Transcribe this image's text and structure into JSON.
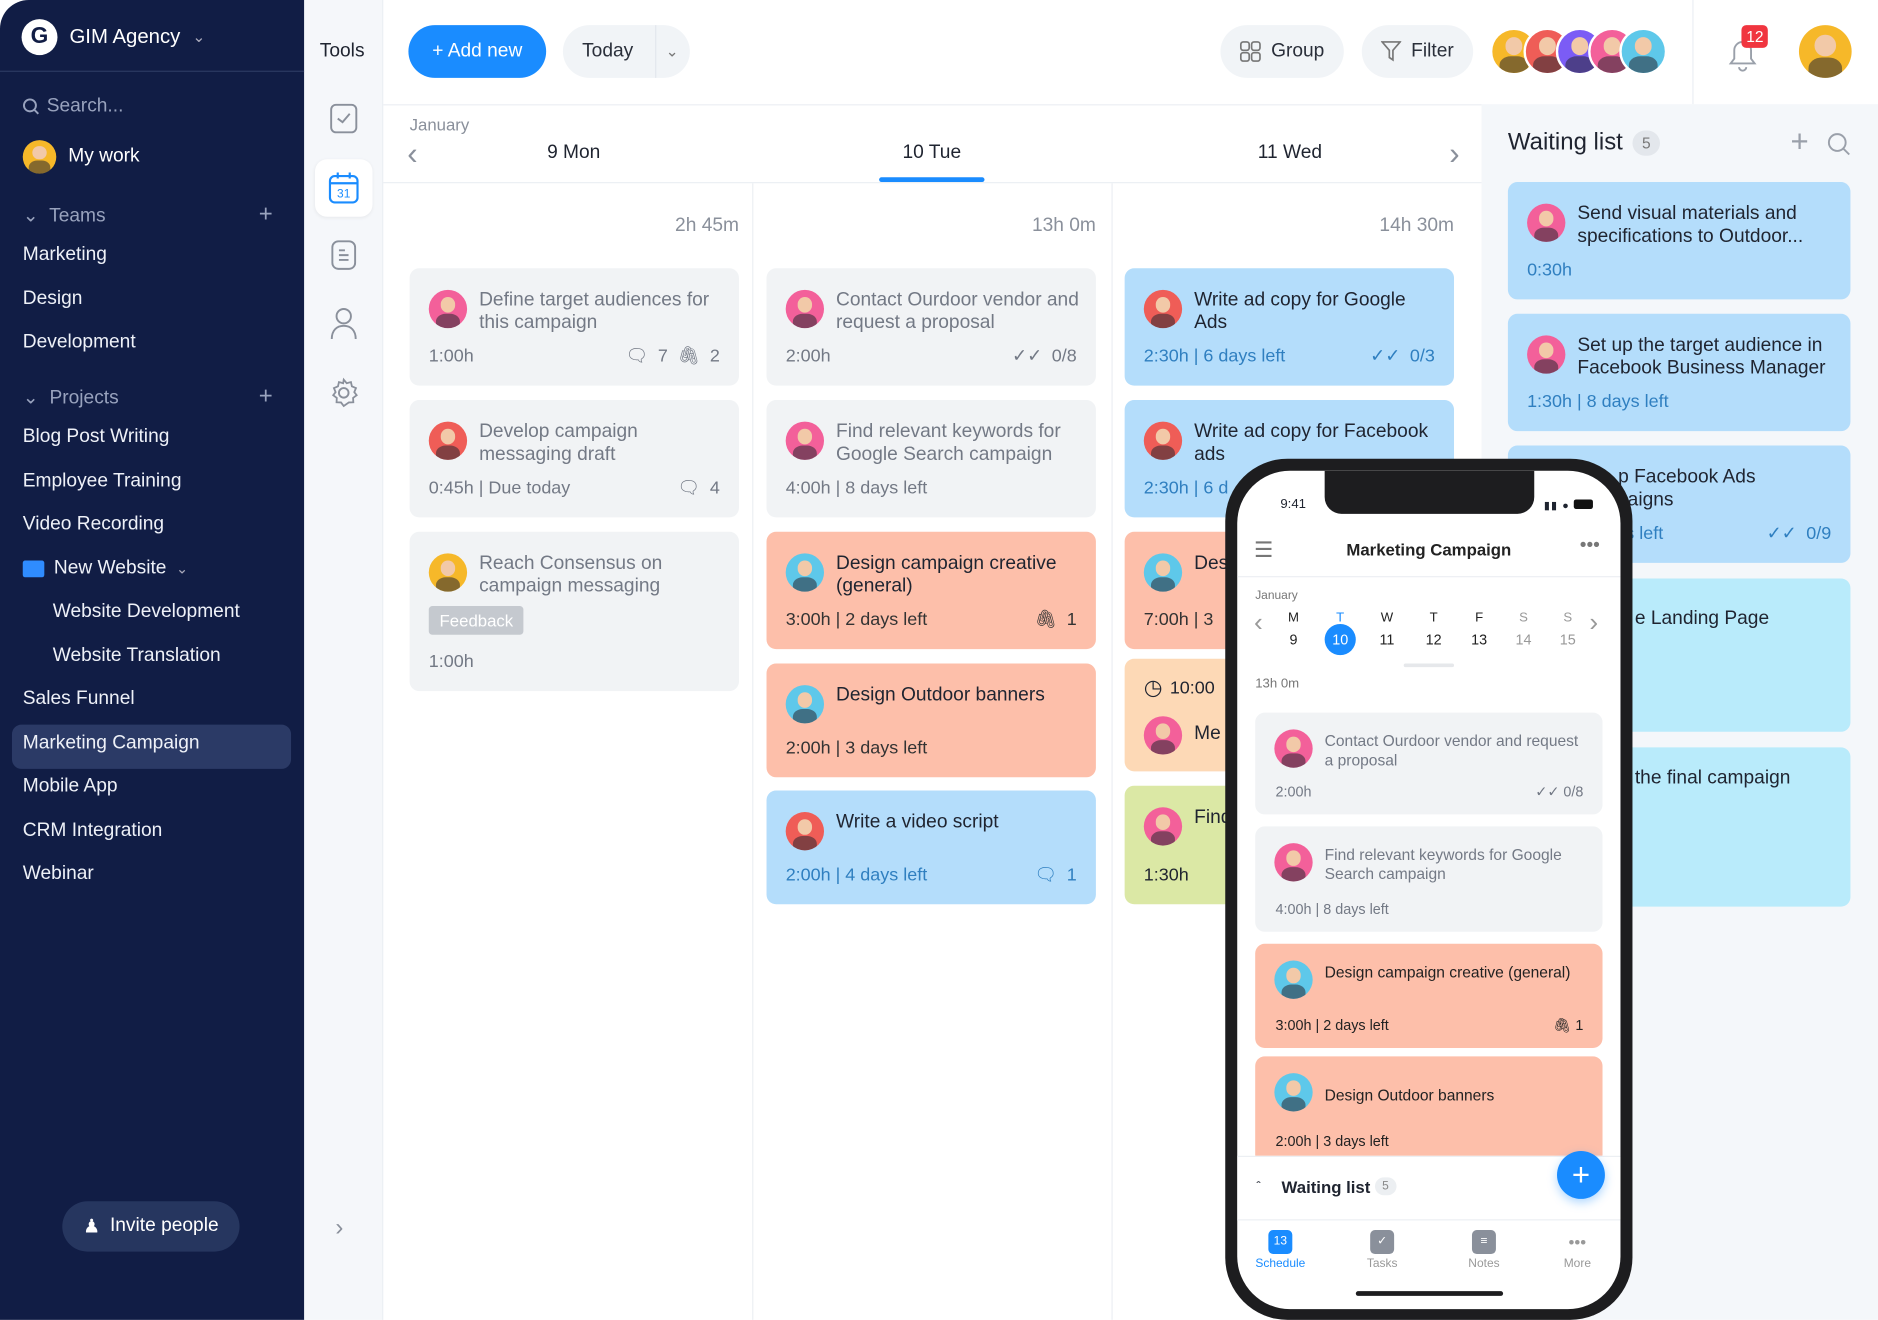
{
  "colors": {
    "accent": "#1a8cff",
    "sidebar": "#111d45",
    "grey_card": "#f1f3f5",
    "blue_card": "#b4ddfb",
    "salmon_card": "#fdbfaa",
    "orange_card": "#fdd9b6",
    "green_card": "#dbe8a5",
    "cyan_card": "#b9ebfb",
    "badge": "#f0353f"
  },
  "sidebar": {
    "workspace": "GIM Agency",
    "search_placeholder": "Search...",
    "my_work": "My work",
    "teams_label": "Teams",
    "teams": [
      "Marketing",
      "Design",
      "Development"
    ],
    "projects_label": "Projects",
    "projects": [
      "Blog Post Writing",
      "Employee Training",
      "Video Recording"
    ],
    "folder": {
      "label": "New Website",
      "children": [
        "Website Development",
        "Website Translation"
      ]
    },
    "projects_after": [
      "Sales Funnel",
      "Marketing Campaign",
      "Mobile App",
      "CRM Integration",
      "Webinar"
    ],
    "active_project": "Marketing Campaign",
    "invite": "Invite people"
  },
  "tools": {
    "label": "Tools",
    "items": [
      "tasks-icon",
      "calendar-icon",
      "notes-icon",
      "people-icon",
      "settings-icon"
    ],
    "active": "calendar-icon",
    "calendar_day": "31"
  },
  "header": {
    "add_new": "+ Add new",
    "today": "Today",
    "group": "Group",
    "filter": "Filter",
    "notifications": "12"
  },
  "calendar": {
    "month": "January",
    "days": [
      {
        "label": "9 Mon",
        "total": "2h 45m",
        "cards": [
          {
            "title": "Define target audiences for this campaign",
            "meta": "1:00h",
            "comments": "7",
            "attachments": "2",
            "color": "grey",
            "avatar": "#f3609a"
          },
          {
            "title": "Develop campaign messaging draft",
            "meta": "0:45h | Due today",
            "comments": "4",
            "color": "grey",
            "avatar": "#ef5d57"
          },
          {
            "title": "Reach Consensus on campaign messaging",
            "tag": "Feedback",
            "meta": "1:00h",
            "color": "grey",
            "avatar": "#f6b829"
          }
        ]
      },
      {
        "label": "10 Tue",
        "active": true,
        "total": "13h 0m",
        "cards": [
          {
            "title": "Contact Ourdoor vendor and request a proposal",
            "meta": "2:00h",
            "checks": "0/8",
            "color": "grey",
            "avatar": "#f3609a"
          },
          {
            "title": "Find relevant keywords for Google Search campaign",
            "meta": "4:00h | 8 days left",
            "color": "grey",
            "avatar": "#f3609a"
          },
          {
            "title": "Design campaign creative (general)",
            "meta": "3:00h | 2 days left",
            "attachments": "1",
            "color": "salmon",
            "avatar": "#5ec8ea"
          },
          {
            "title": "Design Outdoor banners",
            "meta": "2:00h | 3 days left",
            "color": "salmon",
            "avatar": "#5ec8ea"
          },
          {
            "title": "Write a video script",
            "meta": "2:00h | 4 days left",
            "comments": "1",
            "color": "blue",
            "avatar": "#ef5d57"
          }
        ]
      },
      {
        "label": "11 Wed",
        "total": "14h 30m",
        "cards": [
          {
            "title": "Write ad copy for Google Ads",
            "meta": "2:30h | 6 days left",
            "checks": "0/3",
            "color": "blue",
            "avatar": "#ef5d57"
          },
          {
            "title": "Write ad copy for Facebook ads",
            "meta": "2:30h | 6 d",
            "color": "blue",
            "avatar": "#ef5d57"
          },
          {
            "title": "Des",
            "meta": "7:00h | 3",
            "color": "salmon",
            "avatar": "#5ec8ea"
          },
          {
            "title": "Me",
            "time": "10:00",
            "color": "orange",
            "avatar": "#f3609a"
          },
          {
            "title": "Find co",
            "meta": "1:30h",
            "color": "green",
            "avatar": "#f3609a"
          }
        ]
      }
    ]
  },
  "waiting_list": {
    "title": "Waiting list",
    "count": "5",
    "cards": [
      {
        "title": "Send visual materials and specifications to Outdoor...",
        "meta": "0:30h",
        "color": "blue"
      },
      {
        "title": "Set up the target audience in Facebook Business Manager",
        "meta": "1:30h | 8 days left",
        "color": "blue"
      },
      {
        "title": "p Facebook Ads",
        "title2": "aigns",
        "meta": "s left",
        "checks": "0/9",
        "color": "blue"
      },
      {
        "title": "e Landing Page",
        "color": "cyan"
      },
      {
        "title": "the final campaign",
        "color": "cyan"
      }
    ]
  },
  "phone": {
    "time": "9:41",
    "title": "Marketing Campaign",
    "month": "January",
    "week": [
      {
        "d": "M",
        "n": "9"
      },
      {
        "d": "T",
        "n": "10",
        "active": true
      },
      {
        "d": "W",
        "n": "11"
      },
      {
        "d": "T",
        "n": "12"
      },
      {
        "d": "F",
        "n": "13"
      },
      {
        "d": "S",
        "n": "14",
        "weekend": true
      },
      {
        "d": "S",
        "n": "15",
        "weekend": true
      }
    ],
    "total": "13h 0m",
    "cards": [
      {
        "title": "Contact Ourdoor vendor and request a proposal",
        "meta": "2:00h",
        "right": "0/8",
        "color": "grey"
      },
      {
        "title": "Find relevant keywords for Google Search campaign",
        "meta": "4:00h | 8 days left",
        "color": "grey"
      },
      {
        "title": "Design campaign creative (general)",
        "meta": "3:00h | 2 days left",
        "right": "1",
        "color": "salmon"
      },
      {
        "title": "Design Outdoor banners",
        "meta": "2:00h | 3 days left",
        "color": "salmon"
      }
    ],
    "waiting": "Waiting list",
    "waiting_count": "5",
    "tabs": [
      {
        "label": "Schedule",
        "active": true,
        "day": "13"
      },
      {
        "label": "Tasks"
      },
      {
        "label": "Notes"
      },
      {
        "label": "More"
      }
    ]
  }
}
